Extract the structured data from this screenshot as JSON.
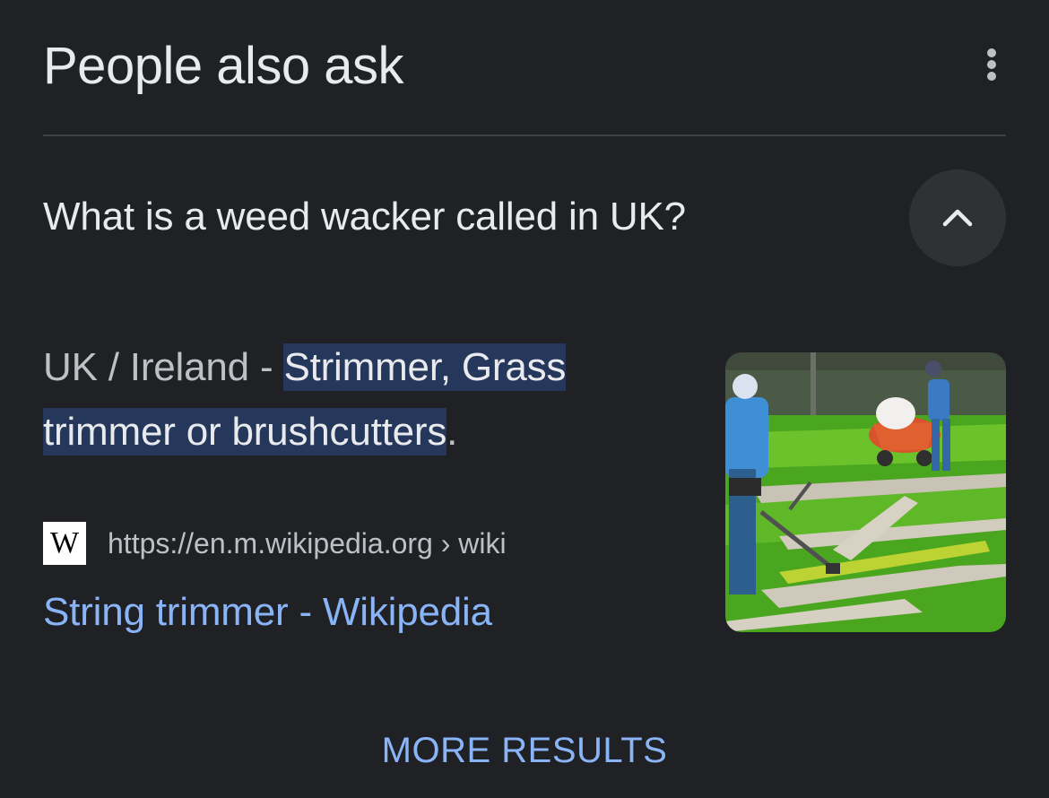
{
  "header": {
    "title": "People also ask",
    "menu_icon": "more-vert-icon"
  },
  "question": {
    "text": "What is a weed wacker called in UK?",
    "toggle_icon": "chevron-up-icon",
    "expanded": true
  },
  "answer": {
    "prefix": "UK / Ireland - ",
    "highlight_line1": "Strimmer, Grass",
    "highlight_line2": "trimmer or brushcutters",
    "suffix": "."
  },
  "source": {
    "favicon_letter": "W",
    "url": "https://en.m.wikipedia.org",
    "path_separator": "›",
    "path": "wiki",
    "title": "String trimmer - Wikipedia"
  },
  "thumbnail": {
    "description_icon": "image-thumbnail"
  },
  "footer": {
    "more_label": "MORE RESULTS"
  },
  "colors": {
    "background": "#202124",
    "text_primary": "#e8eaed",
    "text_secondary": "#bdc1c6",
    "link": "#8ab4f8",
    "highlight": "#25375b"
  }
}
